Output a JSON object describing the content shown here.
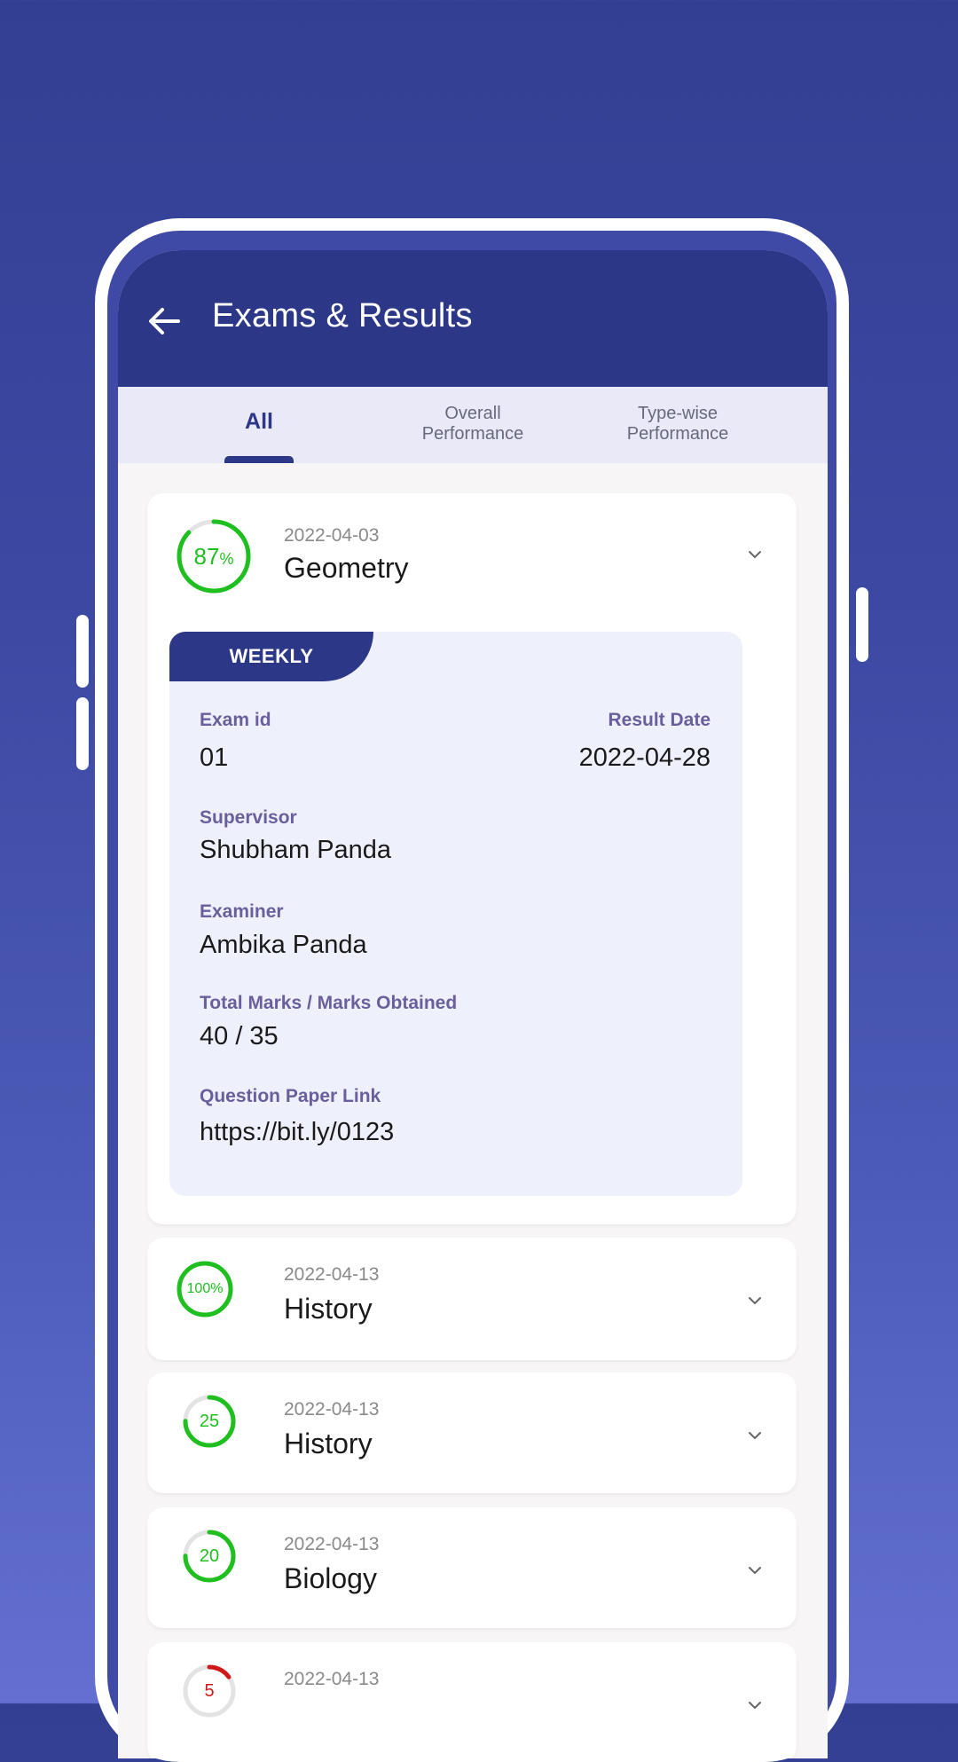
{
  "app_bar": {
    "title": "Exams & Results"
  },
  "tabs": [
    {
      "label": "All"
    },
    {
      "line1": "Overall",
      "line2": "Performance"
    },
    {
      "line1": "Type-wise",
      "line2": "Performance"
    }
  ],
  "exams": [
    {
      "percent": "87",
      "percent_sign": "%",
      "progress": 0.87,
      "date": "2022-04-03",
      "subject": "Geometry",
      "details": {
        "type_badge": "WEEKLY",
        "exam_id_label": "Exam id",
        "exam_id": "01",
        "result_date_label": "Result Date",
        "result_date": "2022-04-28",
        "supervisor_label": "Supervisor",
        "supervisor": "Shubham Panda",
        "examiner_label": "Examiner",
        "examiner": "Ambika Panda",
        "marks_label": "Total Marks / Marks Obtained",
        "marks": "40 / 35",
        "paper_link_label": "Question Paper Link",
        "paper_link": "https://bit.ly/0123"
      }
    },
    {
      "ring_text": "100%",
      "progress": 1.0,
      "date": "2022-04-13",
      "subject": "History"
    },
    {
      "ring_text": "25",
      "progress": 0.75,
      "date": "2022-04-13",
      "subject": "History"
    },
    {
      "ring_text": "20",
      "progress": 0.75,
      "date": "2022-04-13",
      "subject": "Biology"
    },
    {
      "ring_text": "5",
      "progress": 0.15,
      "date": "2022-04-13"
    }
  ],
  "colors": {
    "primary": "#2d3788",
    "ring_good": "#1fbf1f",
    "ring_bad": "#d01818",
    "ring_track": "#e3e3e3"
  }
}
